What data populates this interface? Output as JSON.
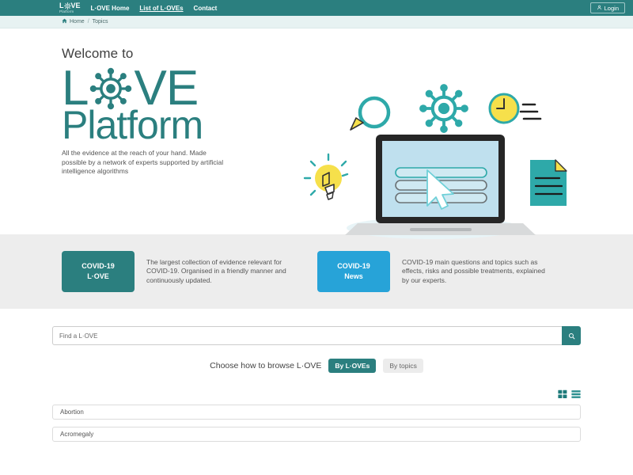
{
  "navbar": {
    "brand": {
      "text_before": "L",
      "text_after": "VE",
      "icon": "virus-icon",
      "subtitle": "Platform"
    },
    "links": [
      {
        "label": "L·OVE Home",
        "active": false
      },
      {
        "label": "List of L·OVEs",
        "active": true
      },
      {
        "label": "Contact",
        "active": false
      }
    ],
    "login": {
      "label": "Login",
      "icon": "user-icon"
    },
    "background_color": "#2b7f7f"
  },
  "breadcrumb": {
    "home_icon": "home-icon",
    "home_label": "Home",
    "separator": "/",
    "current": "Topics"
  },
  "hero": {
    "welcome": "Welcome to",
    "logo_love_before": "L",
    "logo_love_after": "VE",
    "logo_platform": "Platform",
    "subtitle": "All the evidence at the reach of your hand. Made possible by a network of experts supported by artificial intelligence algorithms",
    "illustration_icons": [
      "magnifier-icon",
      "virus-icon",
      "clock-icon",
      "lightbulb-icon",
      "laptop-icon",
      "cursor-icon",
      "document-icon"
    ]
  },
  "covid_band": {
    "background_color": "#ededed",
    "cards": [
      {
        "button_line1": "COVID-19",
        "button_line2": "L·OVE",
        "button_color": "#2b7f7f",
        "description": "The largest collection of evidence relevant for COVID-19. Organised in a friendly manner and continuously updated."
      },
      {
        "button_line1": "COVID-19",
        "button_line2": "News",
        "button_color": "#27a3d8",
        "description": "COVID-19 main questions and topics such as effects, risks and possible treatments, explained by our experts."
      }
    ]
  },
  "search": {
    "placeholder": "Find a L·OVE",
    "value": "",
    "button_icon": "search-icon"
  },
  "browse": {
    "label": "Choose how to browse L·OVE",
    "options": [
      {
        "label": "By L·OVEs",
        "active": true
      },
      {
        "label": "By topics",
        "active": false
      }
    ]
  },
  "view_toggle": {
    "options": [
      {
        "icon": "grid-view-icon",
        "active": true
      },
      {
        "icon": "list-view-icon",
        "active": false
      }
    ]
  },
  "list": {
    "items": [
      {
        "label": "Abortion"
      },
      {
        "label": "Acromegaly"
      }
    ]
  },
  "colors": {
    "teal": "#2b7f7f",
    "blue": "#27a3d8",
    "yellow": "#f6e04b",
    "light_blue": "#bfe0ee",
    "band_gray": "#ededed"
  }
}
